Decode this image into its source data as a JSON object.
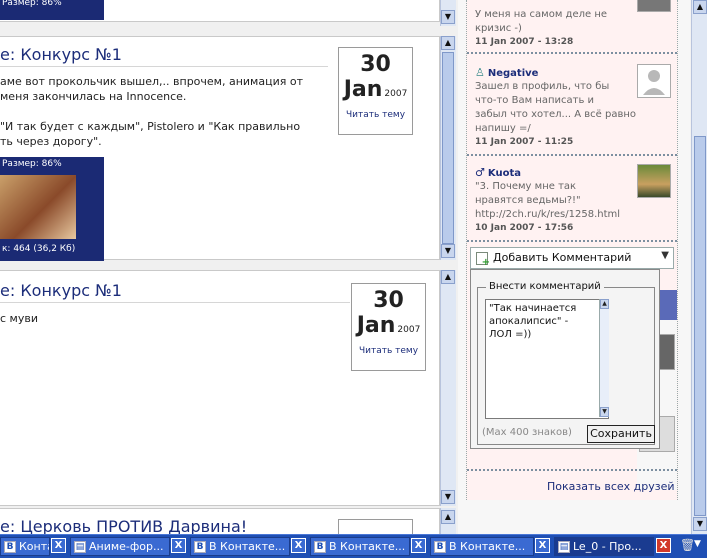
{
  "posts": [
    {
      "title": "",
      "size_label": "Размер: 86%"
    },
    {
      "title": "е: Конкурс №1",
      "text_lines": [
        "аме вот прокольчик вышел,.. впрочем, анимация от",
        "меня закончилась на Innocence.",
        "",
        "\"И так будет с каждым\", Pistolero и \"Как правильно",
        "ть через дорогу\"."
      ],
      "size_label": "Размер: 86%",
      "caption": "к: 464 (36,2 Кб)",
      "day": "30",
      "month": "Jan",
      "year": "2007",
      "link": "Читать тему"
    },
    {
      "title": "е: Конкурс №1",
      "text_lines": [
        "с муви"
      ],
      "day": "30",
      "month": "Jan",
      "year": "2007",
      "link": "Читать тему"
    },
    {
      "title": "е: Церковь ПРОТИВ Дарвина!"
    }
  ],
  "comments": [
    {
      "name": "",
      "text_lines": [
        "У меня на самом деле не",
        "кризис -)"
      ],
      "date": "11 Jan 2007 - 13:28"
    },
    {
      "name": "Negative",
      "text_lines": [
        "Зашел в профиль, что бы",
        "что-то Вам написать и",
        "забыл что хотел... А всё равно",
        "напишу =/"
      ],
      "date": "11 Jan 2007 - 11:25"
    },
    {
      "name": "Kuota",
      "text_lines": [
        "\"3. Почему мне так",
        "нравятся ведьмы?!\"",
        "http://2ch.ru/k/res/1258.html"
      ],
      "date": "10 Jan 2007 - 17:56"
    }
  ],
  "add_comment": {
    "label": "Добавить Комментарий",
    "legend": "Внести комментарий",
    "text": "\"Так начинается\nапокалипсис\" -\nЛОЛ =))",
    "max_hint": "(Max 400 знаков)",
    "save": "Сохранить"
  },
  "show_all_friends": "Показать всех друзей",
  "taskbar": {
    "tasks": [
      {
        "icon": "vk-icon",
        "label": "Контакте..."
      },
      {
        "icon": "doc-icon",
        "label": "Аниме-фор..."
      },
      {
        "icon": "vk-icon",
        "label": "В Контакте..."
      },
      {
        "icon": "vk-icon",
        "label": "В Контакте..."
      },
      {
        "icon": "vk-icon",
        "label": "В Контакте..."
      },
      {
        "icon": "doc-icon",
        "label": "Le_0 - Про..."
      }
    ]
  },
  "colors": {
    "link": "#1c2d7a",
    "taskbar": "#1f4fb4",
    "comment_bg": "#fff2f2"
  }
}
